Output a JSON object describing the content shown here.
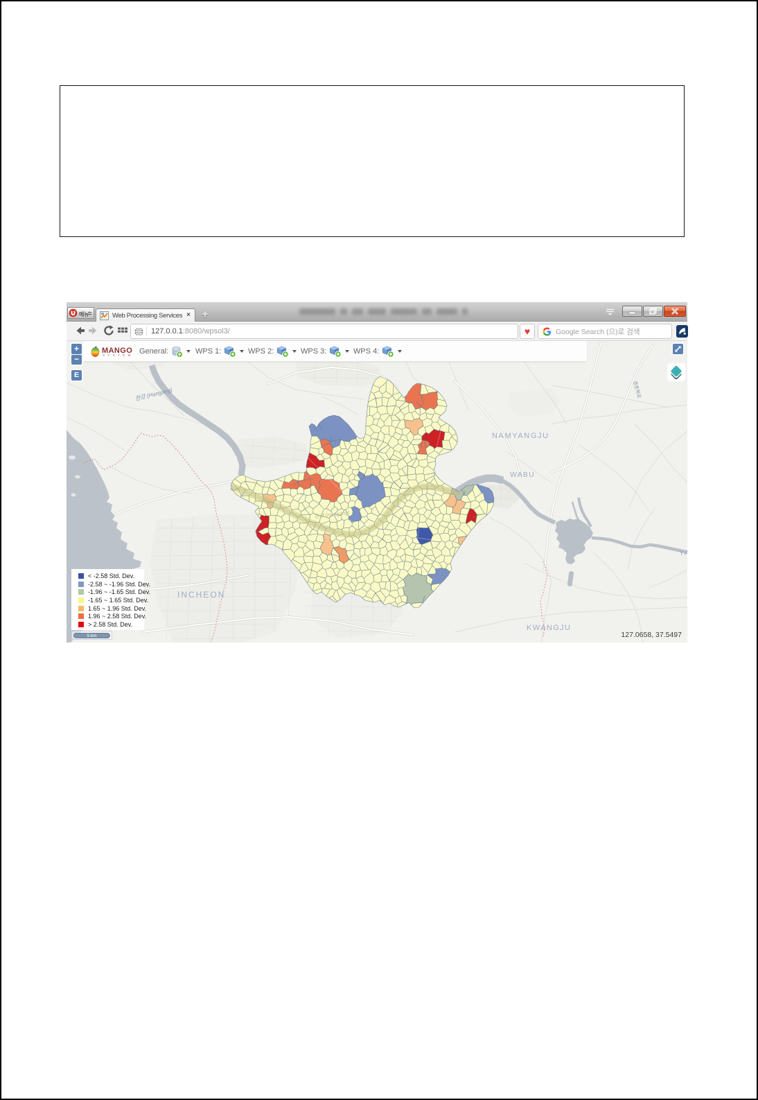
{
  "page": {
    "note_box": ""
  },
  "browser": {
    "menu_button_label": "메뉴",
    "tab_title": "Web Processing Services",
    "tab_close": "×",
    "new_tab": "+",
    "url_host": "127.0.0.1",
    "url_path": ":8080/wpsol3/",
    "search_placeholder": "Google Search (으)로 검색"
  },
  "app": {
    "logo_text": "MANGO",
    "logo_sub": "S Y S T E M",
    "menus": [
      {
        "label": "General:"
      },
      {
        "label": "WPS 1:"
      },
      {
        "label": "WPS 2:"
      },
      {
        "label": "WPS 3:"
      },
      {
        "label": "WPS 4:"
      }
    ],
    "zoom_in": "+",
    "zoom_out": "−",
    "extent_button": "E"
  },
  "map": {
    "labels": {
      "hangang": "한강 (Hangang)",
      "hangang_inner": "한강 (Hangang)",
      "namyangju": "NAMYANGJU",
      "wabu": "WABU",
      "incheon": "INCHEON",
      "kwangju": "KWANGJU",
      "yang": "YANG",
      "road": "경춘북로"
    },
    "legend": {
      "items": [
        {
          "label": "< -2.58 Std. Dev.",
          "color": "#3d52a5"
        },
        {
          "label": "-2.58 ~ -1.96 Std. Dev.",
          "color": "#8296c8"
        },
        {
          "label": "-1.96 ~ -1.65 Std. Dev.",
          "color": "#b1c8a4"
        },
        {
          "label": "-1.65 ~ 1.65 Std. Dev.",
          "color": "#f6f787"
        },
        {
          "label": "1.65 ~ 1.96 Std. Dev.",
          "color": "#f5b96d"
        },
        {
          "label": "1.96 ~ 2.58 Std. Dev.",
          "color": "#ec6e3f"
        },
        {
          "label": "> 2.58 Std. Dev.",
          "color": "#e30b10"
        }
      ]
    },
    "scale_bar": "5 km",
    "mouse_position": "127.0658, 37.5497"
  }
}
